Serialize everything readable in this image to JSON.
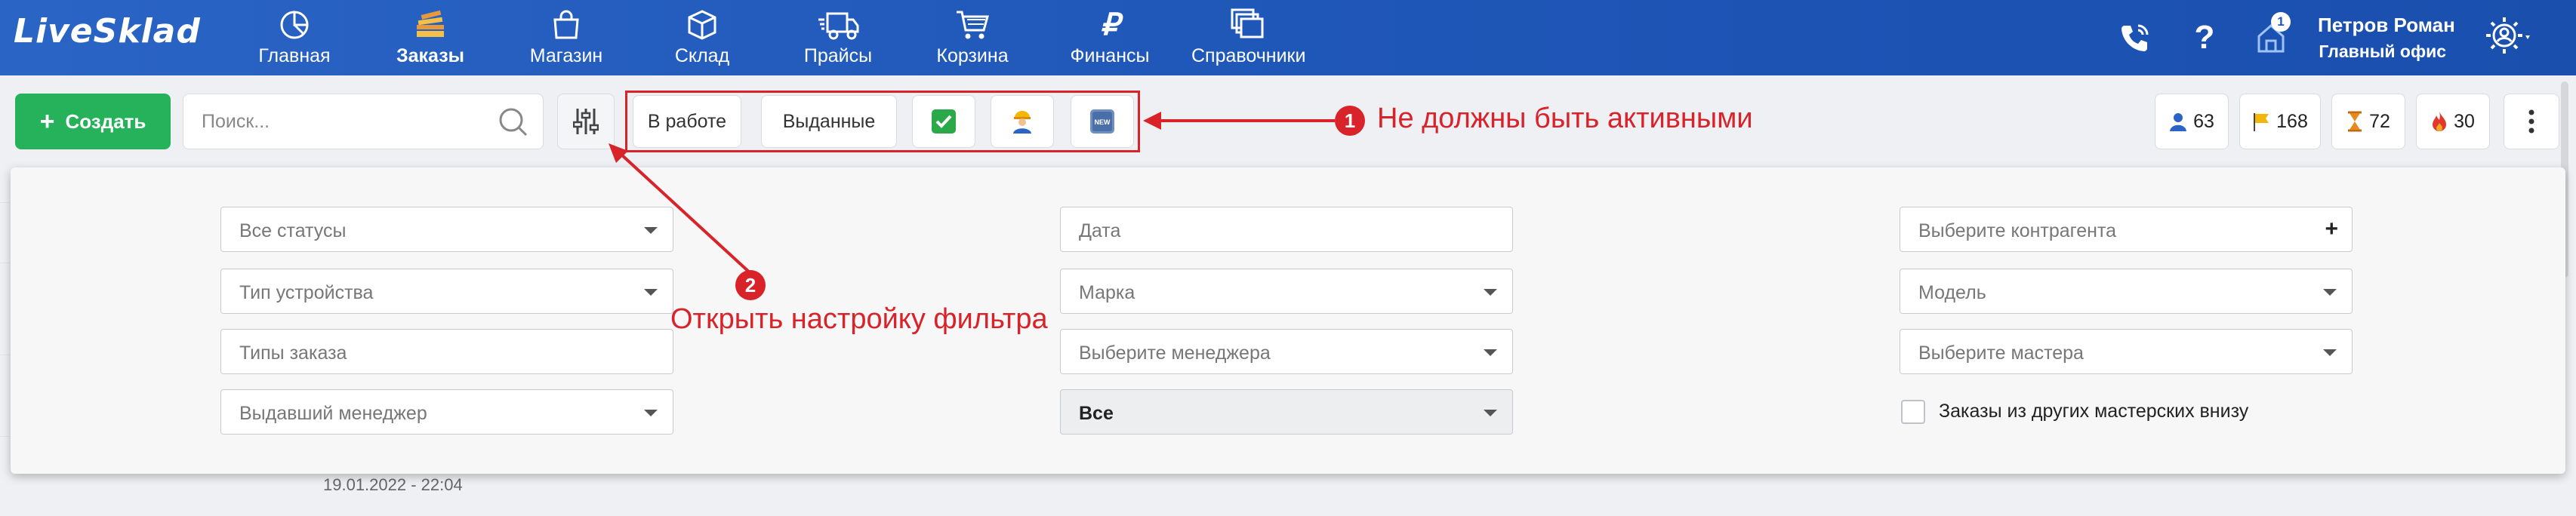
{
  "app": {
    "logo": "LiveSklad"
  },
  "nav": [
    {
      "label": "Главная",
      "icon": "dashboard-icon"
    },
    {
      "label": "Заказы",
      "icon": "orders-icon",
      "active": true
    },
    {
      "label": "Магазин",
      "icon": "shop-bag-icon"
    },
    {
      "label": "Склад",
      "icon": "warehouse-box-icon"
    },
    {
      "label": "Прайсы",
      "icon": "truck-icon"
    },
    {
      "label": "Корзина",
      "icon": "cart-icon"
    },
    {
      "label": "Финансы",
      "icon": "ruble-icon"
    },
    {
      "label": "Справочники",
      "icon": "directories-icon"
    }
  ],
  "topright": {
    "notification_count": "1",
    "user_name": "Петров Роман",
    "office": "Главный офис"
  },
  "toolbar": {
    "create_label": "Создать",
    "search_placeholder": "Поиск...",
    "chips": [
      "В работе",
      "Выданные"
    ],
    "counters": [
      {
        "value": "63",
        "icon": "person-icon",
        "color": "#2a64c4"
      },
      {
        "value": "168",
        "icon": "flag-icon",
        "color": "#f2b705"
      },
      {
        "value": "72",
        "icon": "hourglass-icon",
        "color": "#e8891b"
      },
      {
        "value": "30",
        "icon": "fire-icon",
        "color": "#e0392c"
      }
    ]
  },
  "annotations": {
    "one_number": "1",
    "one_text": "Не должны быть активными",
    "two_number": "2",
    "two_text": "Открыть настройку фильтра",
    "color": "#d9232a"
  },
  "filters": {
    "col1": [
      "Все статусы",
      "Тип устройства",
      "Типы заказа",
      "Выдавший менеджер"
    ],
    "col2": [
      "Дата",
      "Марка",
      "Выберите менеджера",
      "Все"
    ],
    "col3": [
      "Выберите контрагента",
      "Модель",
      "Выберите мастера"
    ],
    "checkbox_label": "Заказы из других мастерских внизу"
  },
  "background_row": {
    "date": "19.01.2022 - 22:04"
  }
}
